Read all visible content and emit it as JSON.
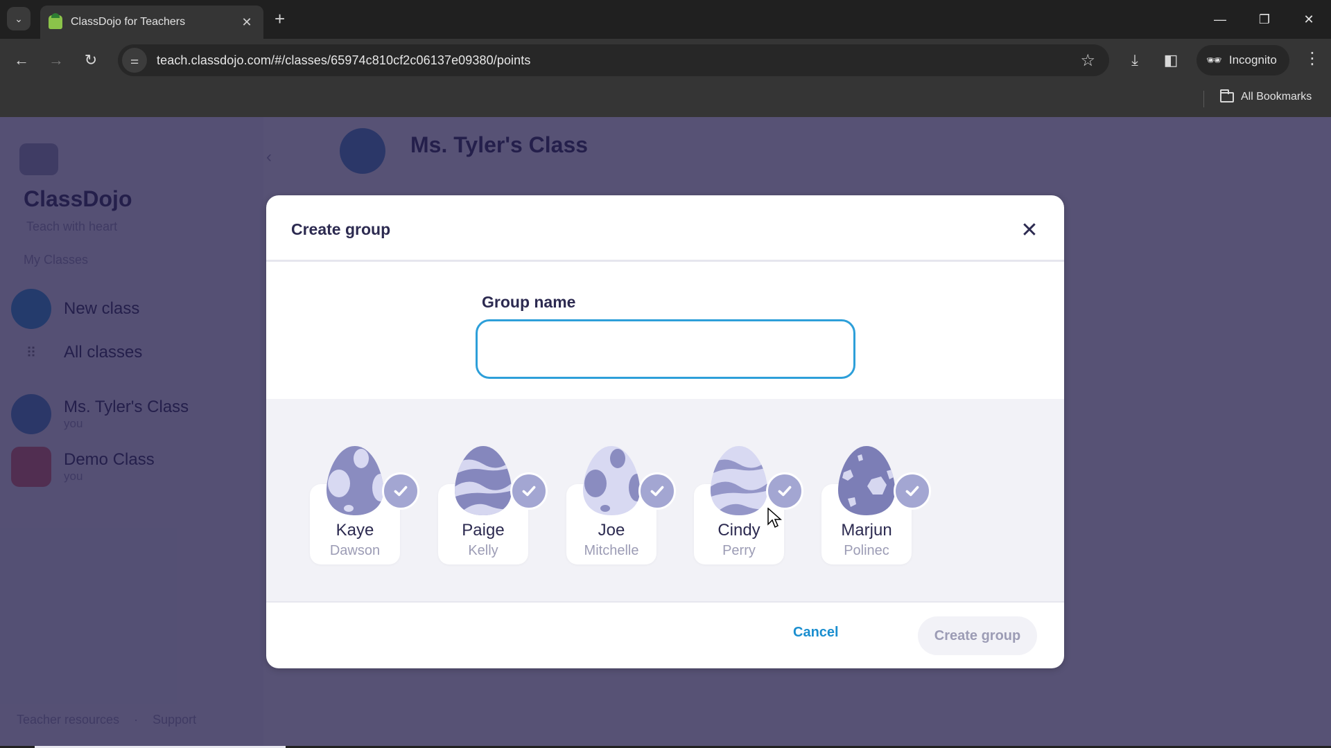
{
  "browser": {
    "tab_title": "ClassDojo for Teachers",
    "url": "teach.classdojo.com/#/classes/65974c810cf2c06137e09380/points",
    "profile_label": "Incognito",
    "bookmarks_label": "All Bookmarks",
    "icons": {
      "tab_search": "chevron-down-icon",
      "favicon": "classdojo-favicon",
      "tab_close": "close-icon",
      "new_tab": "plus-icon",
      "back": "arrow-left-icon",
      "forward": "arrow-right-icon",
      "reload": "reload-icon",
      "site_info": "tune-icon",
      "bookmark": "star-icon",
      "download": "download-icon",
      "side_panel": "side-panel-icon",
      "incognito": "incognito-icon",
      "menu": "more-vert-icon",
      "folder": "folder-icon",
      "minimize": "minimize-icon",
      "restore": "restore-icon",
      "close": "close-icon"
    },
    "glyphs": {
      "tab_search": "⌄",
      "tab_close": "✕",
      "new_tab": "+",
      "back": "←",
      "forward": "→",
      "reload": "↻",
      "site_info": "⚌",
      "bookmark": "☆",
      "download": "⤓",
      "side_panel": "◧",
      "incognito": "🕶",
      "menu": "⋮",
      "minimize": "—",
      "restore": "❐",
      "close": "✕"
    }
  },
  "sidebar": {
    "brand": "ClassDojo",
    "brand_sub": "Teach with heart",
    "section_title": "My Classes",
    "items": [
      {
        "label": "New class",
        "sub": "",
        "icon": "plus-icon",
        "color": "#2d9fd9"
      },
      {
        "label": "All classes",
        "sub": "",
        "icon": "grid-icon",
        "color": ""
      },
      {
        "label": "Ms. Tyler's Class",
        "sub": "you",
        "icon": "class-avatar",
        "color": "#4a90c8"
      },
      {
        "label": "Demo Class",
        "sub": "you",
        "icon": "class-avatar",
        "color": "#e46b6b"
      }
    ],
    "collapse_glyph": "‹"
  },
  "class_header": {
    "title": "Ms. Tyler's Class"
  },
  "footer_links": {
    "teacher_resources": "Teacher resources",
    "separator": "·",
    "support": "Support"
  },
  "modal": {
    "title": "Create group",
    "close_glyph": "✕",
    "field_label": "Group name",
    "input_value": "",
    "input_placeholder": "",
    "students": [
      {
        "first": "Kaye",
        "last": "Dawson",
        "selected": true,
        "egg": "spots"
      },
      {
        "first": "Paige",
        "last": "Kelly",
        "selected": true,
        "egg": "waves"
      },
      {
        "first": "Joe",
        "last": "Mitchelle",
        "selected": true,
        "egg": "light-spots"
      },
      {
        "first": "Cindy",
        "last": "Perry",
        "selected": true,
        "egg": "light-waves"
      },
      {
        "first": "Marjun",
        "last": "Polinec",
        "selected": true,
        "egg": "crystals"
      }
    ],
    "cancel_label": "Cancel",
    "create_label": "Create group",
    "create_enabled": false
  },
  "colors": {
    "accent_blue": "#1a8ecf",
    "input_border": "#2d9fd9",
    "title_text": "#2c2a50",
    "muted_text": "#9c9cb5",
    "check_badge": "#a3a6d2",
    "overlay": "#221c4a"
  }
}
